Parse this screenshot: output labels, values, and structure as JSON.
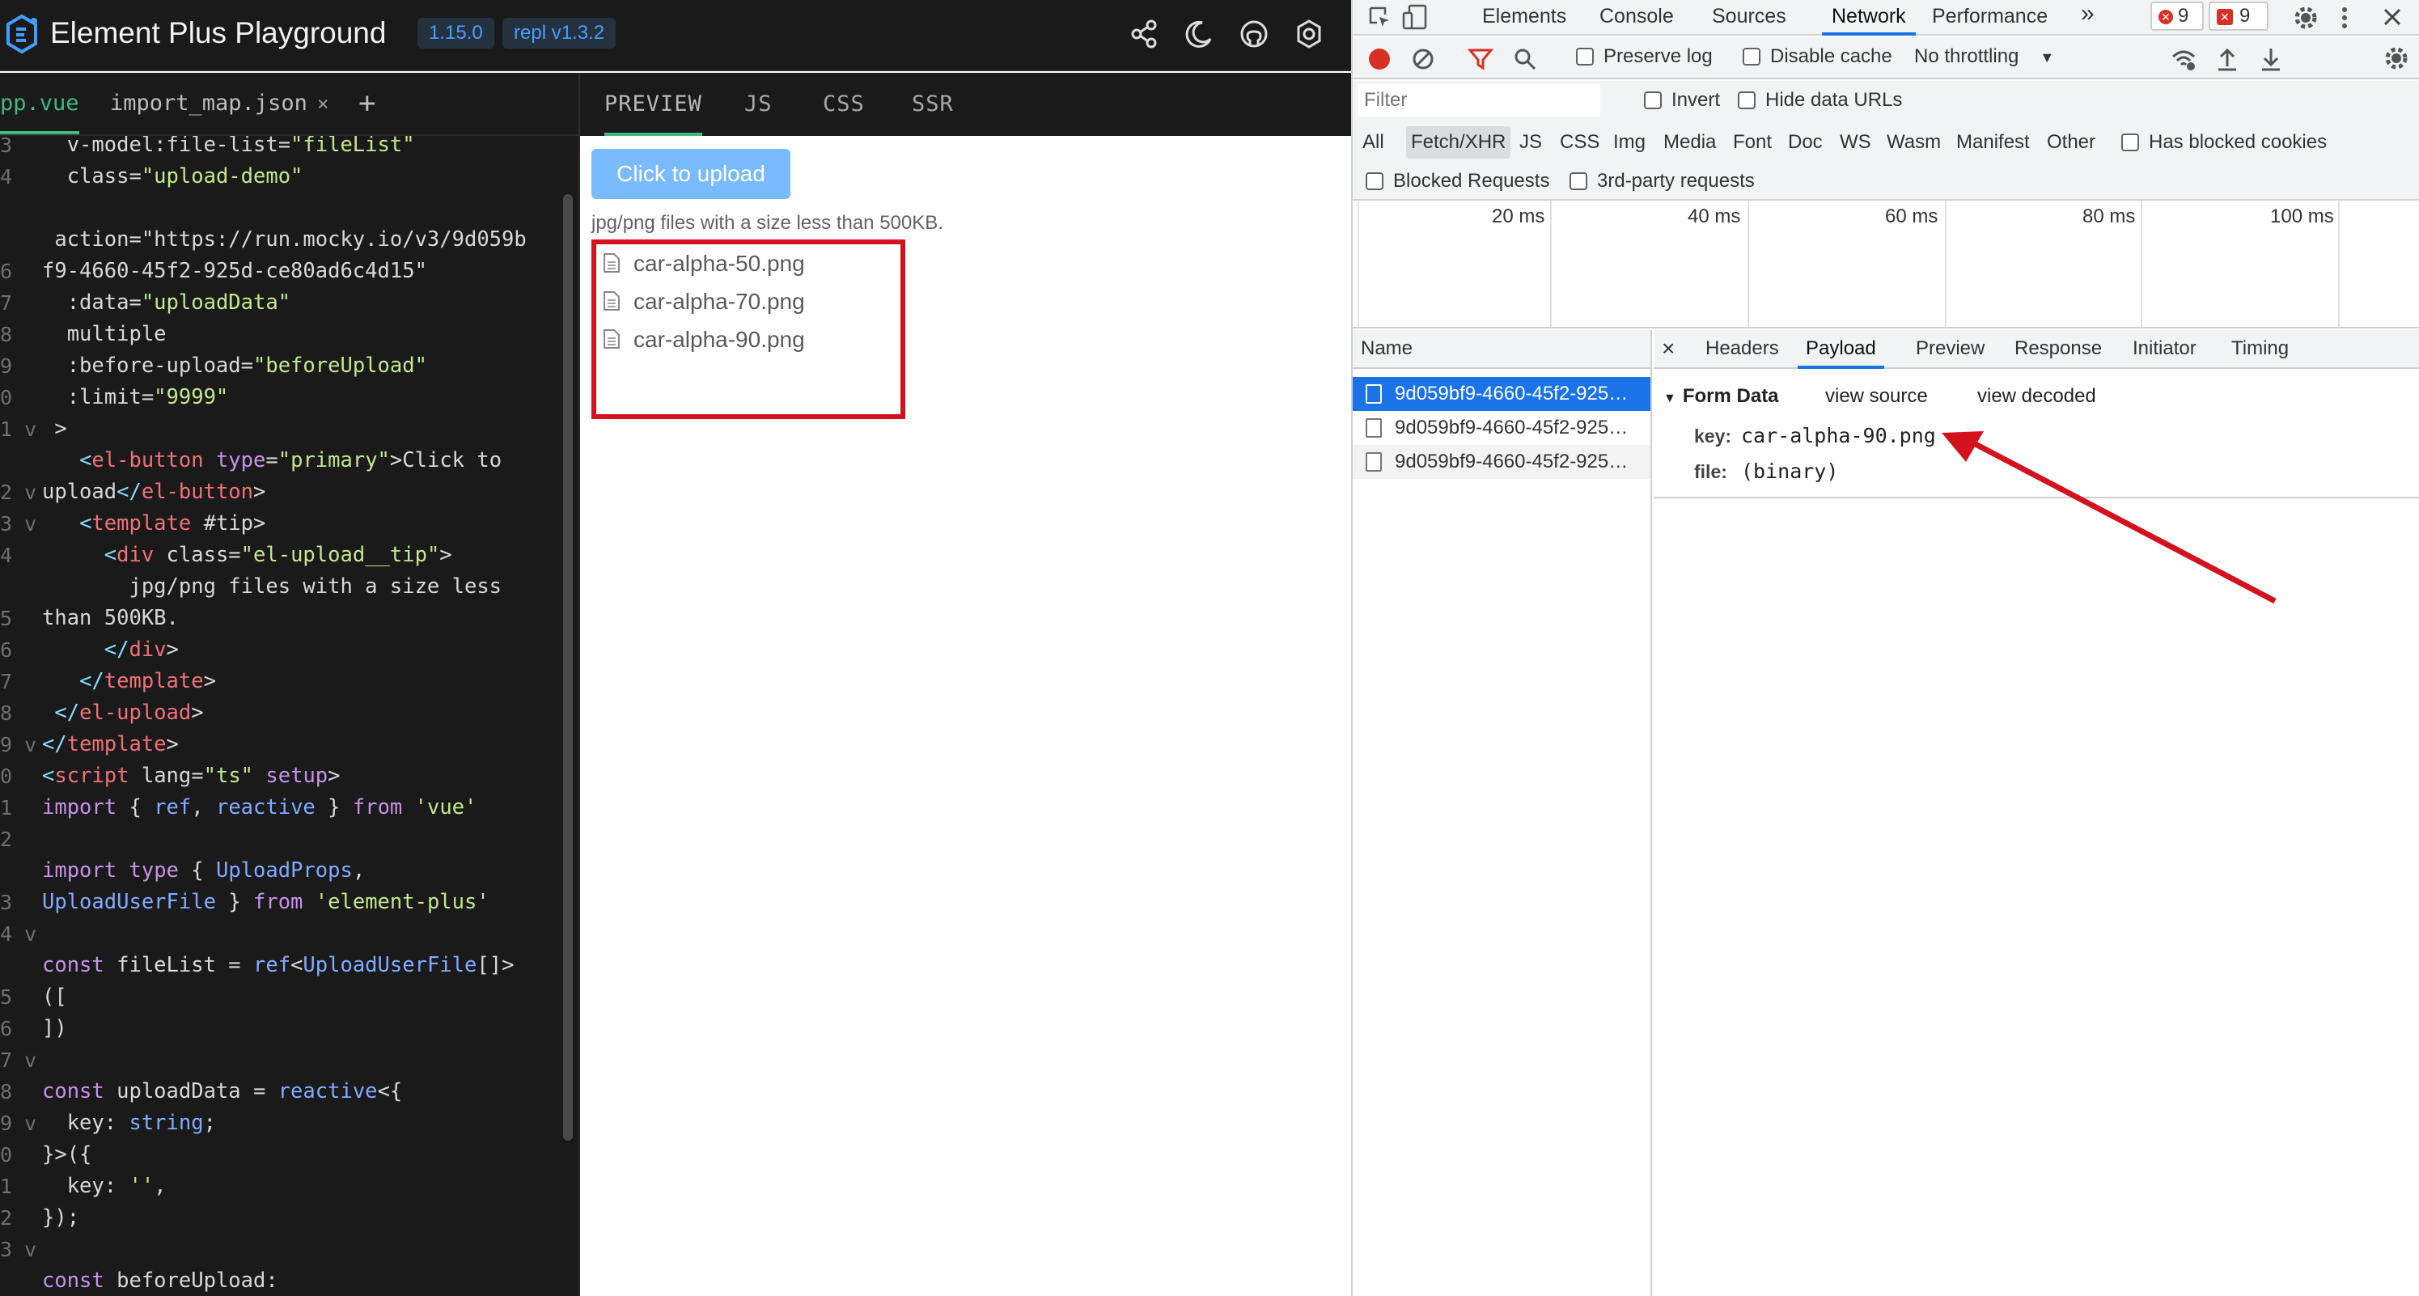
{
  "app": {
    "title": "Element Plus Playground",
    "version_badge": "1.15.0",
    "repl_badge": "repl v1.3.2"
  },
  "file_tabs": [
    {
      "label": "pp.vue"
    },
    {
      "label": "import_map.json"
    }
  ],
  "file_tab_close": "×",
  "file_tab_add": "+",
  "editor": {
    "gutter": [
      "3",
      "4",
      "",
      "",
      "6",
      "7",
      "8",
      "9",
      "0",
      "1 v",
      "",
      "2 v",
      "3 v",
      "4",
      "",
      "5",
      "6",
      "7",
      "8",
      "9 v",
      "0",
      "1",
      "2",
      "",
      "3",
      "4 v",
      "",
      "5",
      "6",
      "7 v",
      "8",
      "9 v",
      "0",
      "1",
      "2",
      "3 v"
    ],
    "lines": [
      "  v-model:file-list=\"fileList\"",
      "  class=\"upload-demo\"",
      "",
      " action=\"https://run.mocky.io/v3/9d059b",
      "f9-4660-45f2-925d-ce80ad6c4d15\"",
      "  :data=\"uploadData\"",
      "  multiple",
      "  :before-upload=\"beforeUpload\"",
      "  :limit=\"9999\"",
      " >",
      "   <el-button type=\"primary\">Click to",
      "upload</el-button>",
      "   <template #tip>",
      "     <div class=\"el-upload__tip\">",
      "       jpg/png files with a size less",
      "than 500KB.",
      "     </div>",
      "   </template>",
      " </el-upload>",
      "</template>",
      "<script lang=\"ts\" setup>",
      "import { ref, reactive } from 'vue'",
      "",
      "import type { UploadProps,",
      "UploadUserFile } from 'element-plus'",
      "",
      "const fileList = ref<UploadUserFile[]>",
      "([",
      "])",
      "",
      "const uploadData = reactive<{",
      "  key: string;",
      "}>({",
      "  key: '',",
      "});",
      "",
      "const beforeUpload:"
    ]
  },
  "preview_tabs": [
    "PREVIEW",
    "JS",
    "CSS",
    "SSR"
  ],
  "preview": {
    "upload_button": "Click to upload",
    "tip": "jpg/png files with a size less than 500KB.",
    "files": [
      "car-alpha-50.png",
      "car-alpha-70.png",
      "car-alpha-90.png"
    ]
  },
  "devtools": {
    "tabs": [
      "Elements",
      "Console",
      "Sources",
      "Network",
      "Performance",
      "»"
    ],
    "error_count": "9",
    "warning_count": "9",
    "toolbar": {
      "preserve_log": "Preserve log",
      "disable_cache": "Disable cache",
      "throttling": "No throttling",
      "throttling_caret": "▼"
    },
    "filter": {
      "placeholder": "Filter",
      "invert": "Invert",
      "hide_data_urls": "Hide data URLs",
      "types": [
        "All",
        "Fetch/XHR",
        "JS",
        "CSS",
        "Img",
        "Media",
        "Font",
        "Doc",
        "WS",
        "Wasm",
        "Manifest",
        "Other"
      ],
      "has_blocked_cookies": "Has blocked cookies",
      "blocked_requests": "Blocked Requests",
      "third_party": "3rd-party requests"
    },
    "timeline_ticks": [
      "20 ms",
      "40 ms",
      "60 ms",
      "80 ms",
      "100 ms"
    ],
    "requests_header": "Name",
    "requests": [
      "9d059bf9-4660-45f2-925…",
      "9d059bf9-4660-45f2-925…",
      "9d059bf9-4660-45f2-925…"
    ],
    "detail_close": "×",
    "detail_tabs": [
      "Headers",
      "Payload",
      "Preview",
      "Response",
      "Initiator",
      "Timing"
    ],
    "form_data": {
      "title": "Form Data",
      "view_source": "view source",
      "view_decoded": "view decoded",
      "rows": [
        {
          "key": "key:",
          "value": "car-alpha-90.png"
        },
        {
          "key": "file:",
          "value": "(binary)"
        }
      ]
    }
  },
  "colors": {
    "accent_green": "#42b883",
    "highlight_red": "#d3121d",
    "devtools_blue": "#1a73e8",
    "upload_button": "#79bbff"
  }
}
